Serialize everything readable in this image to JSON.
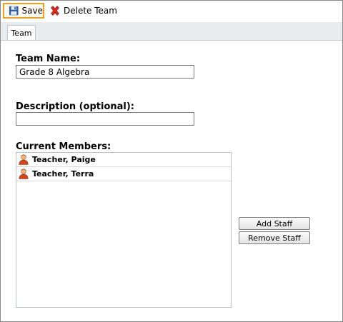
{
  "toolbar": {
    "save_label": "Save",
    "delete_label": "Delete Team"
  },
  "tabs": [
    {
      "label": "Team",
      "active": true
    }
  ],
  "form": {
    "team_name_label": "Team Name:",
    "team_name_value": "Grade 8 Algebra",
    "description_label": "Description (optional):",
    "description_value": "",
    "members_label": "Current Members:"
  },
  "members": [
    {
      "name": "Teacher, Paige",
      "icon": "user-icon"
    },
    {
      "name": "Teacher, Terra",
      "icon": "user-icon"
    }
  ],
  "buttons": {
    "add_staff": "Add Staff",
    "remove_staff": "Remove Staff"
  },
  "colors": {
    "save_highlight": "#f0a020",
    "tab_bar": "#e8ecef",
    "delete_icon": "#d9261c"
  }
}
